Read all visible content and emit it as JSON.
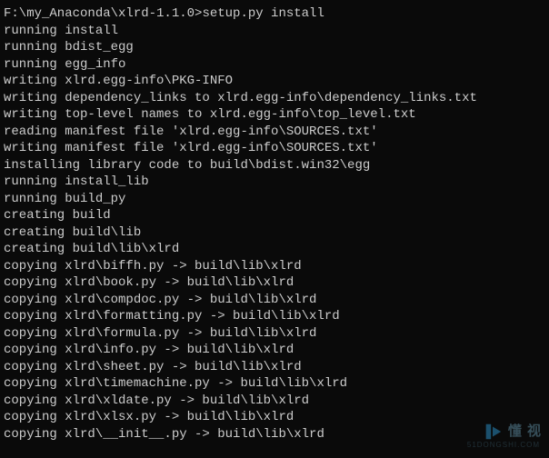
{
  "prompt": {
    "path": "F:\\my_Anaconda\\xlrd-1.1.0>",
    "command": "setup.py install"
  },
  "lines": [
    "running install",
    "running bdist_egg",
    "running egg_info",
    "writing xlrd.egg-info\\PKG-INFO",
    "writing dependency_links to xlrd.egg-info\\dependency_links.txt",
    "writing top-level names to xlrd.egg-info\\top_level.txt",
    "reading manifest file 'xlrd.egg-info\\SOURCES.txt'",
    "writing manifest file 'xlrd.egg-info\\SOURCES.txt'",
    "installing library code to build\\bdist.win32\\egg",
    "running install_lib",
    "running build_py",
    "creating build",
    "creating build\\lib",
    "creating build\\lib\\xlrd",
    "copying xlrd\\biffh.py -> build\\lib\\xlrd",
    "copying xlrd\\book.py -> build\\lib\\xlrd",
    "copying xlrd\\compdoc.py -> build\\lib\\xlrd",
    "copying xlrd\\formatting.py -> build\\lib\\xlrd",
    "copying xlrd\\formula.py -> build\\lib\\xlrd",
    "copying xlrd\\info.py -> build\\lib\\xlrd",
    "copying xlrd\\sheet.py -> build\\lib\\xlrd",
    "copying xlrd\\timemachine.py -> build\\lib\\xlrd",
    "copying xlrd\\xldate.py -> build\\lib\\xlrd",
    "copying xlrd\\xlsx.py -> build\\lib\\xlrd",
    "copying xlrd\\__init__.py -> build\\lib\\xlrd"
  ],
  "watermark": {
    "text": "懂 视",
    "sub": "51DONGSHI.COM"
  }
}
